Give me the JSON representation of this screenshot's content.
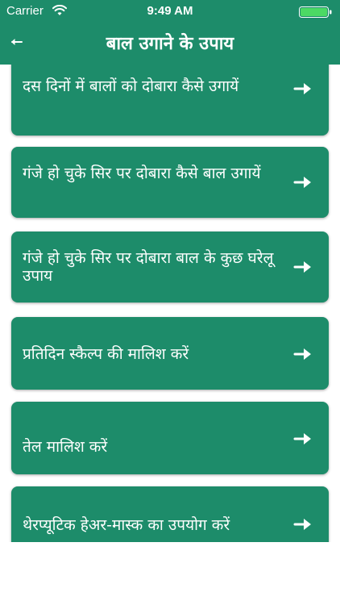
{
  "status_bar": {
    "carrier": "Carrier",
    "time": "9:49 AM"
  },
  "navbar": {
    "back_icon": "back-arrow-icon",
    "title": "बाल उगाने के उपाय"
  },
  "colors": {
    "primary": "#1d8c6a",
    "text_on_primary": "#ffffff",
    "background": "#ffffff",
    "battery": "#4cd964"
  },
  "list": {
    "items": [
      {
        "label": "दस दिनों में बालों को दोबारा कैसे उगायें",
        "icon": "right-arrow-icon"
      },
      {
        "label": "गंजे हो चुके सिर पर दोबारा कैसे बाल उगायें",
        "icon": "right-arrow-icon"
      },
      {
        "label": "गंजे हो चुके सिर पर दोबारा बाल के कुछ घरेलू उपाय",
        "icon": "right-arrow-icon"
      },
      {
        "label": "प्रतिदिन स्कैल्प की मालिश करें",
        "icon": "right-arrow-icon"
      },
      {
        "label": "तेल मालिश करें",
        "icon": "right-arrow-icon"
      },
      {
        "label": "थेरप्यूटिक हेअर-मास्क का उपयोग करें",
        "icon": "right-arrow-icon"
      }
    ]
  }
}
